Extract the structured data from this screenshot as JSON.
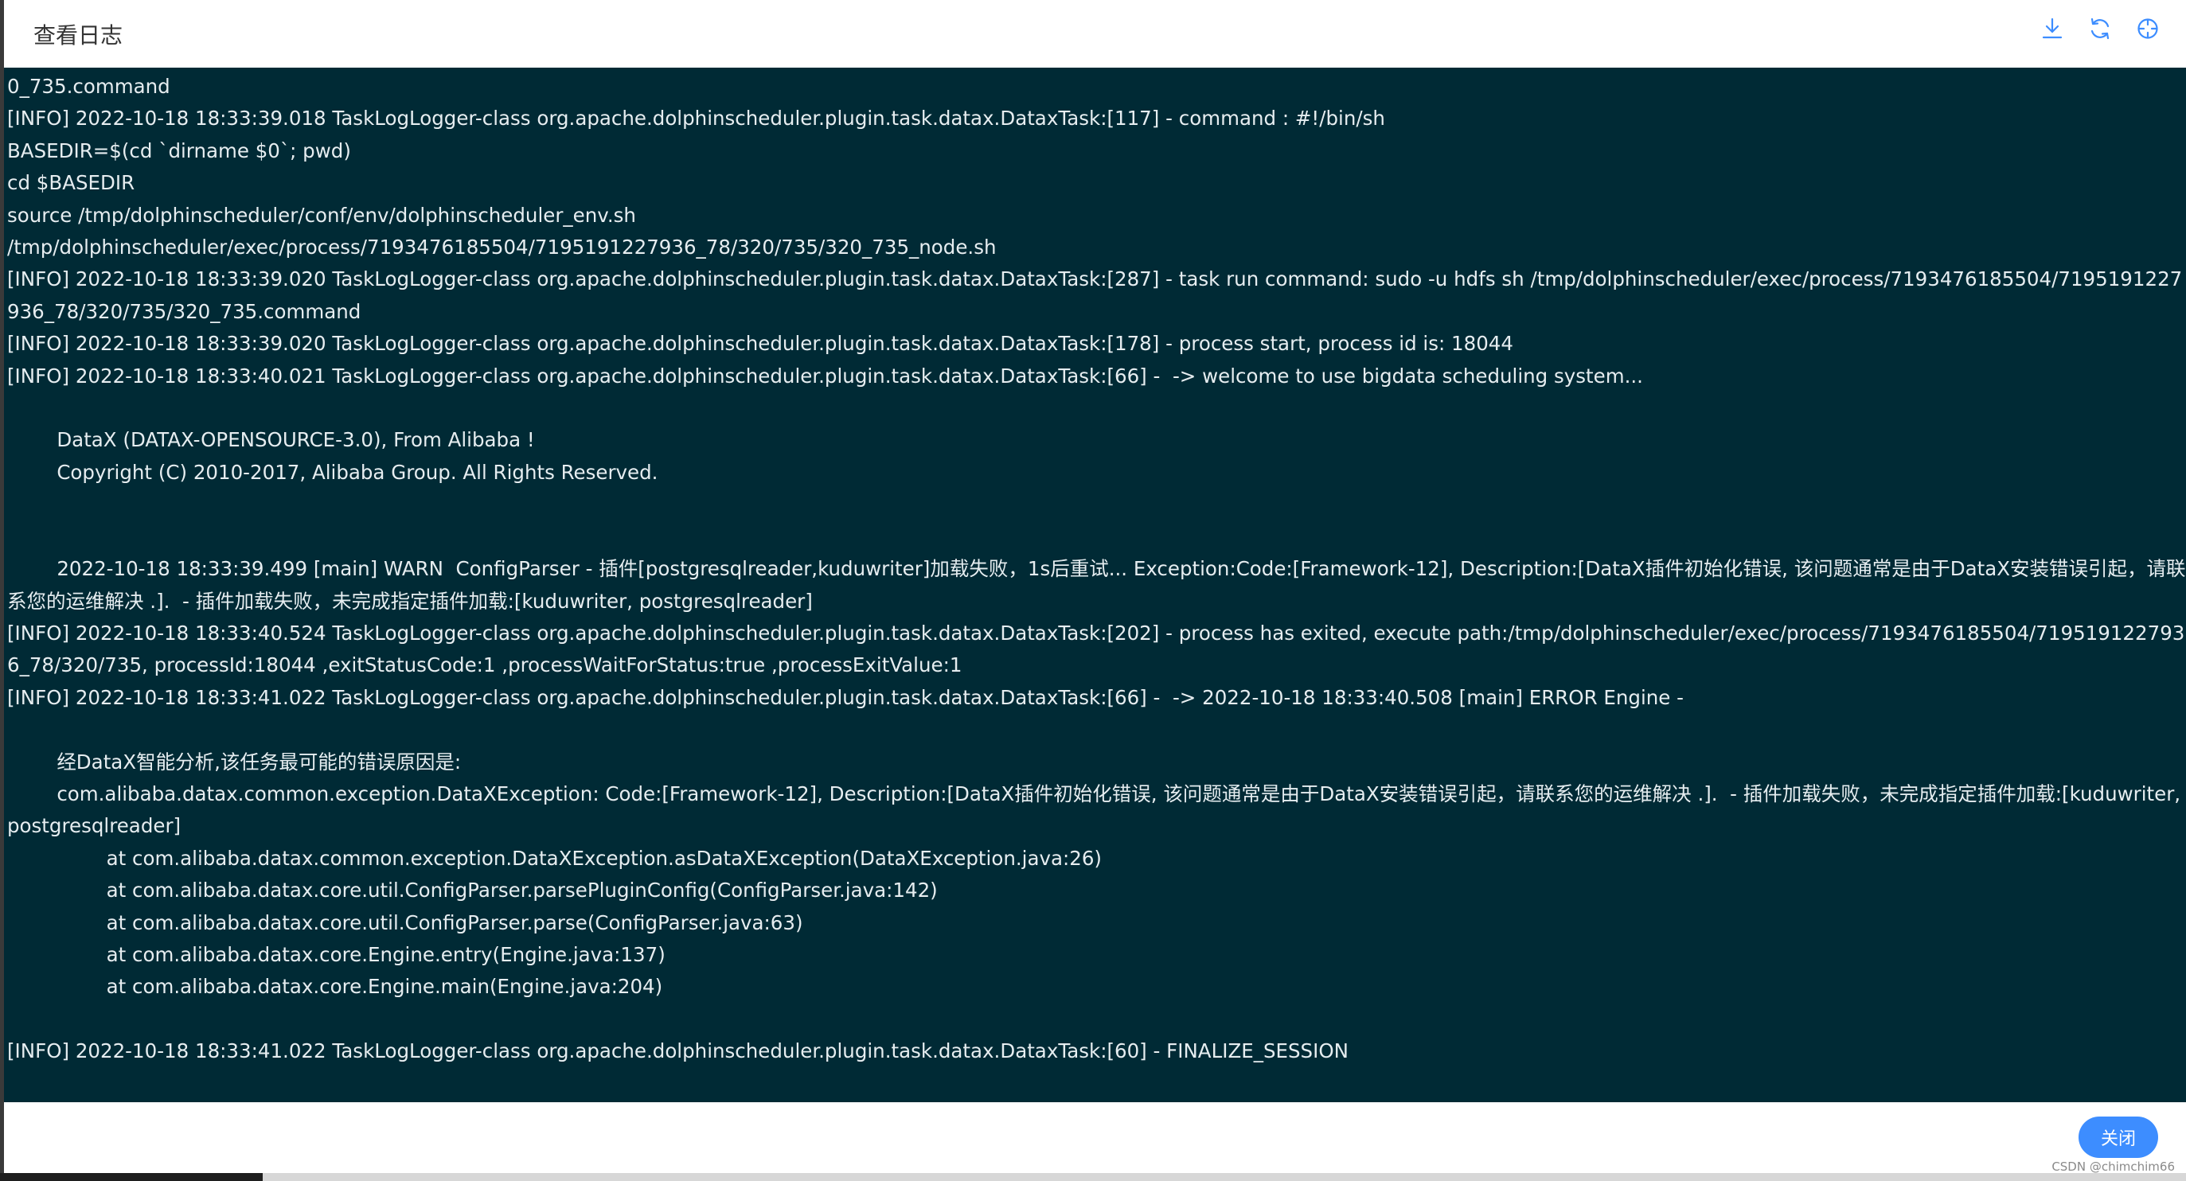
{
  "header": {
    "title": "查看日志",
    "icons": [
      "download-icon",
      "refresh-icon",
      "fullscreen-icon"
    ]
  },
  "log": {
    "lines": [
      "0_735.command",
      "[INFO] 2022-10-18 18:33:39.018 TaskLogLogger-class org.apache.dolphinscheduler.plugin.task.datax.DataxTask:[117] - command : #!/bin/sh",
      "BASEDIR=$(cd `dirname $0`; pwd)",
      "cd $BASEDIR",
      "source /tmp/dolphinscheduler/conf/env/dolphinscheduler_env.sh",
      "/tmp/dolphinscheduler/exec/process/7193476185504/7195191227936_78/320/735/320_735_node.sh",
      "[INFO] 2022-10-18 18:33:39.020 TaskLogLogger-class org.apache.dolphinscheduler.plugin.task.datax.DataxTask:[287] - task run command: sudo -u hdfs sh /tmp/dolphinscheduler/exec/process/7193476185504/7195191227936_78/320/735/320_735.command",
      "[INFO] 2022-10-18 18:33:39.020 TaskLogLogger-class org.apache.dolphinscheduler.plugin.task.datax.DataxTask:[178] - process start, process id is: 18044",
      "[INFO] 2022-10-18 18:33:40.021 TaskLogLogger-class org.apache.dolphinscheduler.plugin.task.datax.DataxTask:[66] -  -> welcome to use bigdata scheduling system...",
      "",
      "        DataX (DATAX-OPENSOURCE-3.0), From Alibaba !",
      "        Copyright (C) 2010-2017, Alibaba Group. All Rights Reserved.",
      "",
      "",
      "        2022-10-18 18:33:39.499 [main] WARN  ConfigParser - 插件[postgresqlreader,kuduwriter]加载失败，1s后重试... Exception:Code:[Framework-12], Description:[DataX插件初始化错误, 该问题通常是由于DataX安装错误引起，请联系您的运维解决 .].  - 插件加载失败，未完成指定插件加载:[kuduwriter, postgresqlreader]",
      "[INFO] 2022-10-18 18:33:40.524 TaskLogLogger-class org.apache.dolphinscheduler.plugin.task.datax.DataxTask:[202] - process has exited, execute path:/tmp/dolphinscheduler/exec/process/7193476185504/7195191227936_78/320/735, processId:18044 ,exitStatusCode:1 ,processWaitForStatus:true ,processExitValue:1",
      "[INFO] 2022-10-18 18:33:41.022 TaskLogLogger-class org.apache.dolphinscheduler.plugin.task.datax.DataxTask:[66] -  -> 2022-10-18 18:33:40.508 [main] ERROR Engine -",
      "",
      "        经DataX智能分析,该任务最可能的错误原因是:",
      "        com.alibaba.datax.common.exception.DataXException: Code:[Framework-12], Description:[DataX插件初始化错误, 该问题通常是由于DataX安装错误引起，请联系您的运维解决 .].  - 插件加载失败，未完成指定插件加载:[kuduwriter, postgresqlreader]",
      "                at com.alibaba.datax.common.exception.DataXException.asDataXException(DataXException.java:26)",
      "                at com.alibaba.datax.core.util.ConfigParser.parsePluginConfig(ConfigParser.java:142)",
      "                at com.alibaba.datax.core.util.ConfigParser.parse(ConfigParser.java:63)",
      "                at com.alibaba.datax.core.Engine.entry(Engine.java:137)",
      "                at com.alibaba.datax.core.Engine.main(Engine.java:204)",
      "",
      "[INFO] 2022-10-18 18:33:41.022 TaskLogLogger-class org.apache.dolphinscheduler.plugin.task.datax.DataxTask:[60] - FINALIZE_SESSION"
    ]
  },
  "footer": {
    "close_label": "关闭",
    "watermark": "CSDN @chimchim66"
  },
  "colors": {
    "log_background": "#002a35",
    "log_text": "#e6edf0",
    "primary_button": "#3d8dff"
  }
}
